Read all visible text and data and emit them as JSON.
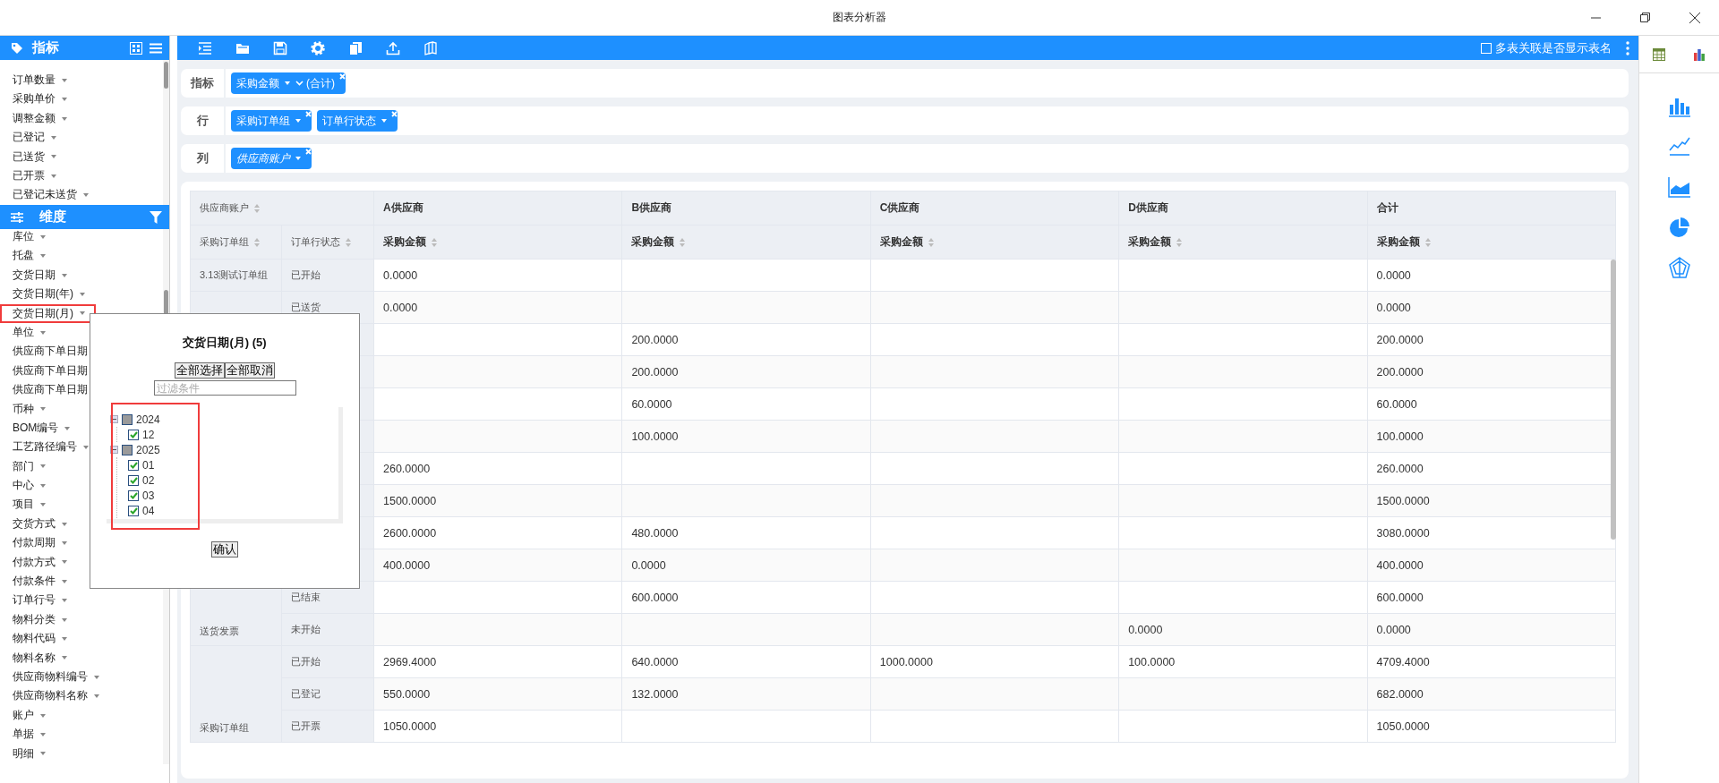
{
  "window": {
    "title": "图表分析器"
  },
  "sidebar": {
    "measures": {
      "title": "指标",
      "items": [
        {
          "label": "订单数量",
          "highlighted": false
        },
        {
          "label": "采购单价",
          "highlighted": false
        },
        {
          "label": "调整金额",
          "highlighted": false
        },
        {
          "label": "已登记",
          "highlighted": false
        },
        {
          "label": "已送货",
          "highlighted": false
        },
        {
          "label": "已开票",
          "highlighted": false
        },
        {
          "label": "已登记未送货",
          "highlighted": false
        }
      ]
    },
    "dimensions": {
      "title": "维度",
      "items": [
        {
          "label": "库位",
          "highlighted": false
        },
        {
          "label": "托盘",
          "highlighted": false
        },
        {
          "label": "交货日期",
          "highlighted": false
        },
        {
          "label": "交货日期(年)",
          "highlighted": false
        },
        {
          "label": "交货日期(月)",
          "highlighted": true
        },
        {
          "label": "单位",
          "highlighted": false
        },
        {
          "label": "供应商下单日期",
          "highlighted": false,
          "covered": true
        },
        {
          "label": "供应商下单日期",
          "highlighted": false,
          "covered": true
        },
        {
          "label": "供应商下单日期",
          "highlighted": false,
          "covered": true
        },
        {
          "label": "币种",
          "highlighted": false
        },
        {
          "label": "BOM编号",
          "highlighted": false
        },
        {
          "label": "工艺路径编号",
          "highlighted": false
        },
        {
          "label": "部门",
          "highlighted": false
        },
        {
          "label": "中心",
          "highlighted": false
        },
        {
          "label": "项目",
          "highlighted": false
        },
        {
          "label": "交货方式",
          "highlighted": false
        },
        {
          "label": "付款周期",
          "highlighted": false
        },
        {
          "label": "付款方式",
          "highlighted": false
        },
        {
          "label": "付款条件",
          "highlighted": false
        },
        {
          "label": "订单行号",
          "highlighted": false
        },
        {
          "label": "物料分类",
          "highlighted": false
        },
        {
          "label": "物料代码",
          "highlighted": false
        },
        {
          "label": "物料名称",
          "highlighted": false
        },
        {
          "label": "供应商物料编号",
          "highlighted": false
        },
        {
          "label": "供应商物料名称",
          "highlighted": false
        },
        {
          "label": "账户",
          "highlighted": false
        },
        {
          "label": "单据",
          "highlighted": false
        },
        {
          "label": "明细",
          "highlighted": false
        }
      ]
    }
  },
  "toolbar": {
    "show_table_names": {
      "label": "多表关联是否显示表名",
      "checked": false
    }
  },
  "shelves": [
    {
      "label": "指标",
      "chips": [
        {
          "label": "采购金额",
          "suffix": "(合计)",
          "italic": false
        }
      ]
    },
    {
      "label": "行",
      "chips": [
        {
          "label": "采购订单组",
          "italic": false
        },
        {
          "label": "订单行状态",
          "italic": false
        }
      ]
    },
    {
      "label": "列",
      "chips": [
        {
          "label": "供应商账户",
          "italic": true
        }
      ]
    }
  ],
  "pivot": {
    "corner": "供应商账户",
    "row_fields": [
      "采购订单组",
      "订单行状态"
    ],
    "columns": [
      {
        "label": "A供应商",
        "measure": "采购金额"
      },
      {
        "label": "B供应商",
        "measure": "采购金额"
      },
      {
        "label": "C供应商",
        "measure": "采购金额"
      },
      {
        "label": "D供应商",
        "measure": "采购金额"
      },
      {
        "label": "合计",
        "measure": "采购金额"
      }
    ],
    "groups": [
      {
        "label": "3.13测试订单组",
        "rows": [
          {
            "status": "已开始",
            "supplier_a": "0.0000",
            "total": "0.0000"
          }
        ]
      },
      {
        "label": "送货发票",
        "rows": [
          {
            "status": "已送货",
            "supplier_a": "0.0000",
            "total": "0.0000"
          },
          {
            "supplier_b": "200.0000",
            "total": "200.0000"
          },
          {
            "supplier_b": "200.0000",
            "total": "200.0000"
          },
          {
            "supplier_b": "60.0000",
            "total": "60.0000"
          },
          {
            "supplier_b": "100.0000",
            "total": "100.0000"
          },
          {
            "supplier_a": "260.0000",
            "total": "260.0000"
          },
          {
            "supplier_a": "1500.0000",
            "total": "1500.0000"
          },
          {
            "supplier_a": "2600.0000",
            "supplier_b": "480.0000",
            "total": "3080.0000"
          },
          {
            "supplier_a": "400.0000",
            "supplier_b": "0.0000",
            "total": "400.0000"
          },
          {
            "status": "已结束",
            "supplier_b": "600.0000",
            "total": "600.0000"
          },
          {
            "status": "未开始",
            "supplier_d": "0.0000",
            "total": "0.0000"
          }
        ]
      },
      {
        "label": "采购订单组",
        "rows": [
          {
            "status": "已开始",
            "supplier_a": "2969.4000",
            "supplier_b": "640.0000",
            "supplier_c": "1000.0000",
            "supplier_d": "100.0000",
            "total": "4709.4000"
          },
          {
            "status": "已登记",
            "supplier_a": "550.0000",
            "supplier_b": "132.0000",
            "total": "682.0000"
          },
          {
            "status": "已开票",
            "supplier_a": "1050.0000",
            "total": "1050.0000"
          }
        ]
      }
    ]
  },
  "filter_popup": {
    "title": "交货日期(月) (5)",
    "buttons": [
      "全部选择",
      "全部取消"
    ],
    "placeholder": "过滤条件",
    "highlighted": true,
    "tree": [
      {
        "label": "2024",
        "expanded": true,
        "checked": false,
        "indeterminate": true,
        "children": [
          {
            "label": "12",
            "checked": true
          }
        ]
      },
      {
        "label": "2025",
        "expanded": true,
        "checked": false,
        "indeterminate": true,
        "children": [
          {
            "label": "01",
            "checked": true
          },
          {
            "label": "02",
            "checked": true
          },
          {
            "label": "03",
            "checked": true
          },
          {
            "label": "04",
            "checked": true
          }
        ]
      }
    ],
    "confirm": "确认"
  }
}
